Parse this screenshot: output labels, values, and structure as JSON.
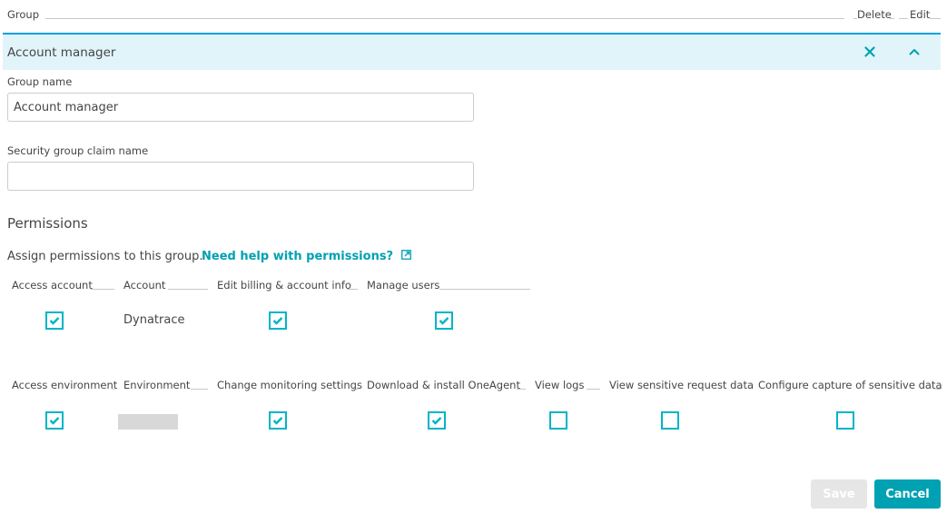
{
  "table_header": {
    "group": "Group",
    "delete": "Delete",
    "edit": "Edit"
  },
  "group_row": {
    "title": "Account manager",
    "delete_icon": "close-icon",
    "collapse_icon": "chevron-up-icon"
  },
  "form": {
    "group_name_label": "Group name",
    "group_name_value": "Account manager",
    "claim_label": "Security group claim name",
    "claim_value": "",
    "claim_placeholder": ""
  },
  "permissions": {
    "title": "Permissions",
    "assign_text": "Assign permissions to this group.",
    "help_link": "Need help with permissions?",
    "help_link_icon": "external-link-icon",
    "account_table": {
      "headers": [
        "Access account",
        "Account",
        "Edit billing & account info",
        "Manage users"
      ],
      "row": {
        "access_account": true,
        "account": "Dynatrace",
        "edit_billing": true,
        "manage_users": true
      }
    },
    "environment_table": {
      "headers": [
        "Access environment",
        "Environment",
        "Change monitoring settings",
        "Download & install OneAgent",
        "View logs",
        "View sensitive request data",
        "Configure capture of sensitive data"
      ],
      "row": {
        "access_environment": true,
        "environment": "[redacted]",
        "change_monitoring": true,
        "download_oneagent": true,
        "view_logs": false,
        "view_sensitive": false,
        "configure_capture": false
      }
    }
  },
  "actions": {
    "save": "Save",
    "cancel": "Cancel"
  },
  "colors": {
    "accent": "#00a1b2",
    "checkbox": "#00b4c8",
    "row_highlight": "#e1f4fa",
    "row_border": "#00a1e0",
    "disabled_button": "#e6e6e6"
  }
}
